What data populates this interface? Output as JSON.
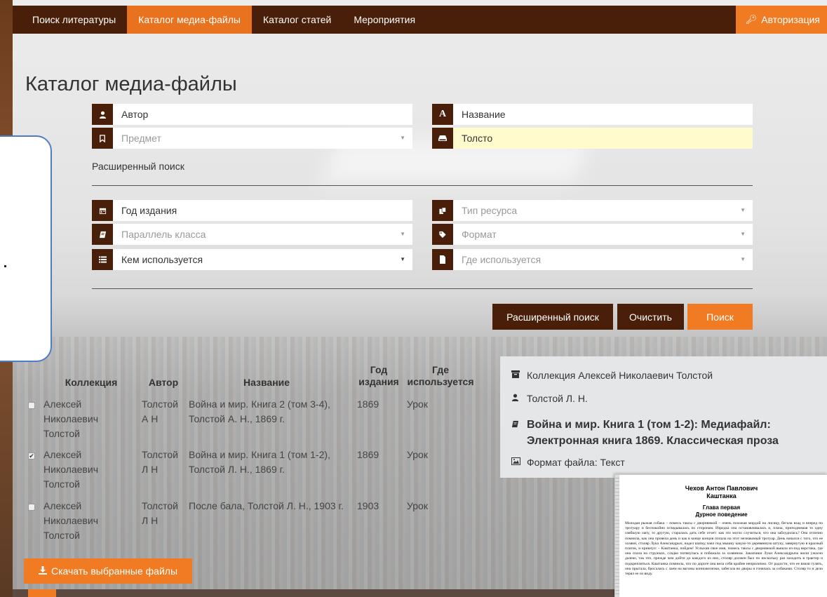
{
  "nav": {
    "items": [
      {
        "label": "Поиск литературы",
        "active": false
      },
      {
        "label": "Каталог медиа-файлы",
        "active": true
      },
      {
        "label": "Каталог статей",
        "active": false
      },
      {
        "label": "Мероприятия",
        "active": false
      }
    ],
    "auth_label": "Авторизация",
    "auth_icon": "key-icon"
  },
  "page": {
    "title": "Каталог медиа-файлы"
  },
  "search": {
    "author_placeholder": "Автор",
    "title_placeholder": "Название",
    "subject_placeholder": "Предмет",
    "keyword_value": "Толсто",
    "advanced_link": "Расширенный поиск",
    "year_placeholder": "Год издания",
    "resource_type_placeholder": "Тип ресурса",
    "class_placeholder": "Параллель класса",
    "format_placeholder": "Формат",
    "used_by_placeholder": "Кем используется",
    "used_where_placeholder": "Где используется"
  },
  "buttons": {
    "advanced": "Расширенный поиск",
    "clear": "Очистить",
    "search": "Поиск",
    "download": "Скачать выбранные файлы"
  },
  "table": {
    "headers": {
      "collection": "Коллекция",
      "author": "Автор",
      "title": "Название",
      "year_line1": "Год",
      "year_line2": "издания",
      "where_line1": "Где",
      "where_line2": "используется"
    },
    "rows": [
      {
        "checked": false,
        "collection": [
          "Алексей",
          "Николаевич",
          "Толстой"
        ],
        "author": [
          "Толстой",
          "А Н"
        ],
        "title": [
          "Война и мир. Книга 2 (том 3-4),",
          "Толстой А. Н., 1869 г."
        ],
        "year": "1869",
        "where": "Урок"
      },
      {
        "checked": true,
        "collection": [
          "Алексей",
          "Николаевич",
          "Толстой"
        ],
        "author": [
          "Толстой",
          "Л Н"
        ],
        "title": [
          "Война и мир. Книга 1 (том 1-2),",
          "Толстой Л. Н., 1869 г."
        ],
        "year": "1869",
        "where": "Урок"
      },
      {
        "checked": false,
        "collection": [
          "Алексей",
          "Николаевич",
          "Толстой"
        ],
        "author": [
          "Толстой",
          "Л Н"
        ],
        "title": [
          "После бала, Толстой Л. Н., 1903 г."
        ],
        "year": "1903",
        "where": "Урок"
      }
    ]
  },
  "detail": {
    "collection": "Коллекция Алексей Николаевич Толстой",
    "author": "Толстой Л. Н.",
    "title_line1": "Война и мир. Книга 1 (том 1-2): Медиафайл:",
    "title_line2": "Электронная книга 1869. Классическая проза",
    "format": "Формат файла: Текст"
  },
  "preview": {
    "author": "Чехов Антон Павлович",
    "work": "Каштанка",
    "chapter": "Глава первая",
    "chapter_title": "Дурное поведение",
    "text": "Молодая рыжая собака – помесь таксы с дворняжкой – очень похожая мордой на лисицу, бегала взад и вперед по тротуару и беспокойно оглядывалась по сторонам. Изредка она останавливалась и, плача, приподнимая то одну озябшую лапу, то другую, старалась дать себе отчет: как это могло случиться, что она заблудилась? Она отлично помнила, как она провела день и как в конце концов попала на этот незнакомый тротуар. День начался с того, что ее хозяин, столяр Лука Александрыч, надел шапку, взял под мышку какую-то деревянную штуку, завернутую в красный платок, и крикнул: – Каштанка, пойдем! Услыхав свое имя, помесь таксы с дворняжкой вышла из-под верстака, где она спала на стружках, сладко потянулась и побежала за хозяином. Заказчики Луки Александрыча жили ужасно далеко, так что, прежде чем дойти до каждого из них, столяр должен был по нескольку раз заходить в трактир и подкрепляться. Каштанка помнила, что по дороге она вела себя крайне неприлично. От радости, что ее взяли гулять, она прыгала, бросалась с лаем на вагоны конножелезки, забегала во дворы и гонялась за собаками. Столяр то и дело терял ее из виду."
  }
}
